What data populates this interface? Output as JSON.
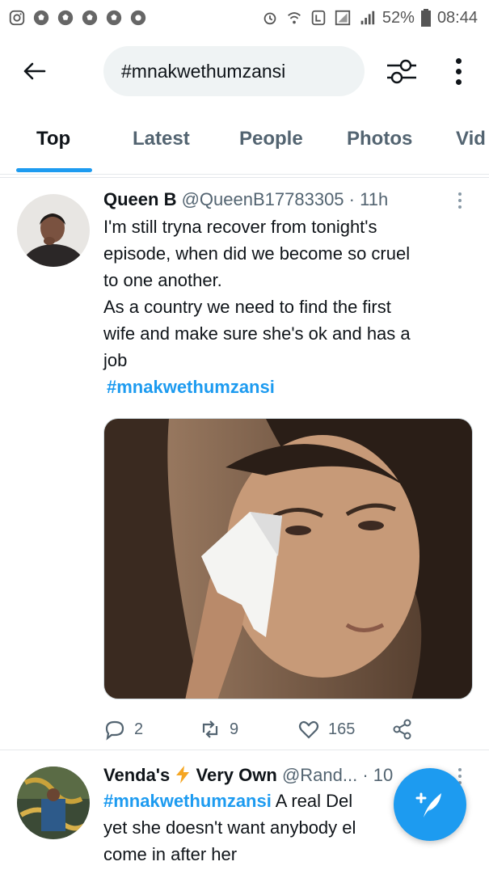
{
  "status_bar": {
    "battery": "52%",
    "time": "08:44",
    "left_icons": [
      "instagram-icon",
      "soccer-ball-icon",
      "soccer-ball-icon",
      "soccer-ball-icon",
      "soccer-ball-icon",
      "chrome-icon"
    ],
    "right_icons": [
      "alarm-icon",
      "wifi-call-icon",
      "volte-icon",
      "signal-icon",
      "battery-icon"
    ]
  },
  "header": {
    "search_value": "#mnakwethumzansi",
    "back_icon": "arrow-left-icon",
    "filter_icon": "sliders-icon",
    "more_icon": "vertical-dots-icon"
  },
  "tabs": [
    {
      "label": "Top",
      "active": true
    },
    {
      "label": "Latest",
      "active": false
    },
    {
      "label": "People",
      "active": false
    },
    {
      "label": "Photos",
      "active": false
    },
    {
      "label": "Vid",
      "active": false
    }
  ],
  "tweets": [
    {
      "name": "Queen B",
      "handle": "@QueenB17783305",
      "time": "· 11h",
      "text_lines": [
        "I'm still tryna recover from tonight's",
        "episode, when did we become so cruel",
        "to one another.",
        "As a country we need to find the first",
        "wife and make sure she's ok and has a",
        "job"
      ],
      "hashtag": "#mnakwethumzansi",
      "media_icon": "photo-woman-crying-with-tissue",
      "replies": "2",
      "retweets": "9",
      "likes": "165"
    },
    {
      "name": "Venda's",
      "name_emoji": "lightning-icon",
      "name_rest": "Very Own",
      "handle": "@Rand...",
      "time": "· 10",
      "hashtag": "#mnakwethumzansi",
      "text_first": "A real Del",
      "text_lines": [
        "yet she doesn't want anybody el",
        "come in after her"
      ]
    }
  ],
  "fab": {
    "icon": "compose-feather-plus-icon"
  },
  "colors": {
    "accent": "#1d9bf0",
    "text": "#0f1419",
    "muted": "#536471",
    "search_bg": "#eff3f4"
  }
}
